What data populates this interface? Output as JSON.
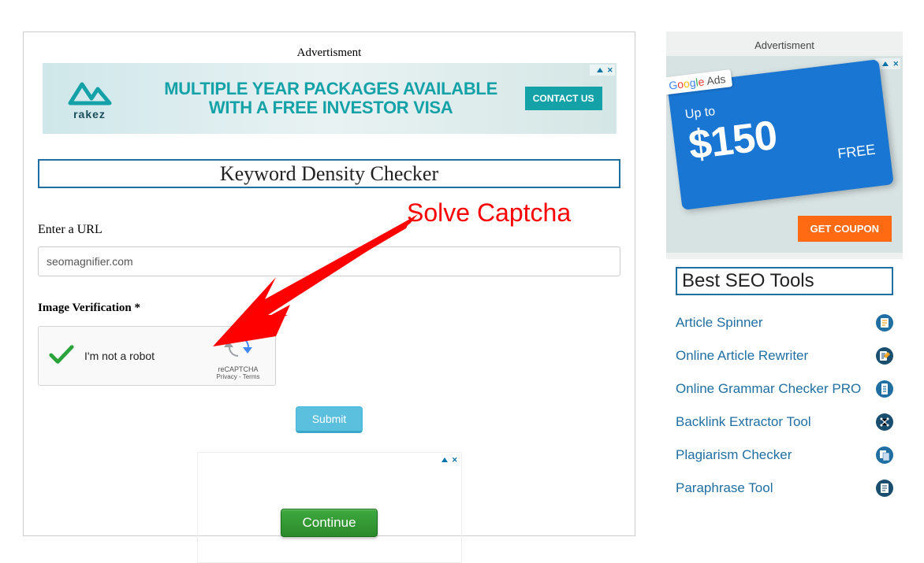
{
  "main": {
    "adv_label": "Advertisment",
    "banner": {
      "brand": "rakez",
      "headline": "MULTIPLE YEAR PACKAGES AVAILABLE\nWITH A FREE INVESTOR VISA",
      "cta": "CONTACT US"
    },
    "title": "Keyword Density Checker",
    "url_label": "Enter a URL",
    "url_value": "seomagnifier.com",
    "verification_label": "Image Verification *",
    "recaptcha": {
      "text": "I'm not a robot",
      "brand": "reCAPTCHA",
      "privacy": "Privacy",
      "terms": "Terms"
    },
    "submit": "Submit",
    "bottom_ad": {
      "cta": "Continue"
    }
  },
  "annotation": {
    "text": "Solve Captcha"
  },
  "sidebar": {
    "adv_label": "Advertisment",
    "ad": {
      "google_ads": "Google Ads",
      "upto": "Up to",
      "amount": "$150",
      "free": "FREE",
      "coupon": "GET COUPON"
    },
    "tools_title": "Best SEO Tools",
    "tools": [
      {
        "label": "Article Spinner"
      },
      {
        "label": "Online Article Rewriter"
      },
      {
        "label": "Online Grammar Checker PRO"
      },
      {
        "label": "Backlink Extractor Tool"
      },
      {
        "label": "Plagiarism Checker"
      },
      {
        "label": "Paraphrase Tool"
      }
    ]
  },
  "ad_controls": {
    "close": "✕"
  }
}
